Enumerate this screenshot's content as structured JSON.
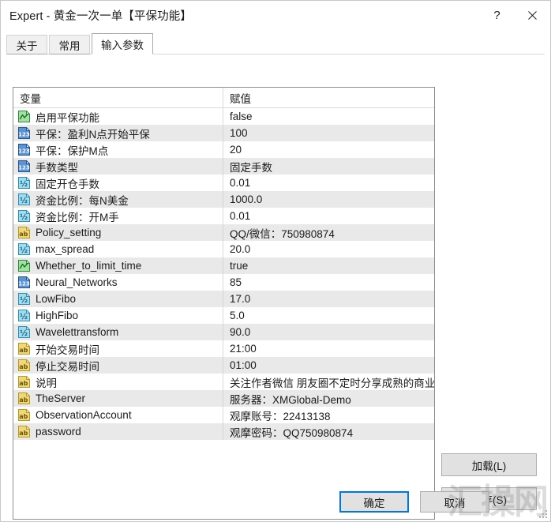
{
  "window": {
    "title": "Expert - 黄金一次一单【平保功能】",
    "help_label": "?",
    "close_label": "✕"
  },
  "tabs": [
    {
      "label": "关于",
      "name": "tab-about",
      "active": false
    },
    {
      "label": "常用",
      "name": "tab-common",
      "active": false
    },
    {
      "label": "输入参数",
      "name": "tab-inputs",
      "active": true
    }
  ],
  "table": {
    "headers": {
      "variable": "变量",
      "value": "赋值"
    },
    "rows": [
      {
        "icon": "bool-icon",
        "name": "启用平保功能",
        "value": "false"
      },
      {
        "icon": "int-icon",
        "name": "平保：盈利N点开始平保",
        "value": "100"
      },
      {
        "icon": "int-icon",
        "name": "平保：保护M点",
        "value": "20"
      },
      {
        "icon": "int-icon",
        "name": "手数类型",
        "value": "固定手数"
      },
      {
        "icon": "double-icon",
        "name": "固定开仓手数",
        "value": "0.01"
      },
      {
        "icon": "double-icon",
        "name": "资金比例：每N美金",
        "value": "1000.0"
      },
      {
        "icon": "double-icon",
        "name": "资金比例：开M手",
        "value": "0.01"
      },
      {
        "icon": "string-icon",
        "name": "Policy_setting",
        "value": "QQ/微信：750980874"
      },
      {
        "icon": "double-icon",
        "name": "max_spread",
        "value": "20.0"
      },
      {
        "icon": "bool-icon",
        "name": "Whether_to_limit_time",
        "value": "true"
      },
      {
        "icon": "int-icon",
        "name": "Neural_Networks",
        "value": "85"
      },
      {
        "icon": "double-icon",
        "name": "LowFibo",
        "value": "17.0"
      },
      {
        "icon": "double-icon",
        "name": "HighFibo",
        "value": "5.0"
      },
      {
        "icon": "double-icon",
        "name": "Wavelettransform",
        "value": "90.0"
      },
      {
        "icon": "string-icon",
        "name": "开始交易时间",
        "value": "21:00"
      },
      {
        "icon": "string-icon",
        "name": "停止交易时间",
        "value": "01:00"
      },
      {
        "icon": "string-icon",
        "name": "说明",
        "value": "关注作者微信 朋友圈不定时分享成熟的商业EA"
      },
      {
        "icon": "string-icon",
        "name": "TheServer",
        "value": "服务器：XMGlobal-Demo"
      },
      {
        "icon": "string-icon",
        "name": "ObservationAccount",
        "value": "观摩账号：22413138"
      },
      {
        "icon": "string-icon",
        "name": "password",
        "value": "观摩密码：QQ750980874"
      }
    ]
  },
  "side_buttons": {
    "load": "加载(L)",
    "save": "保存(S)"
  },
  "footer_buttons": {
    "ok": "确定",
    "cancel": "取消"
  },
  "watermark": {
    "text": "汇操网"
  },
  "colors": {
    "accent": "#0078d7",
    "row_alt": "#e9e9e9",
    "button_face": "#e1e1e1",
    "border": "#8a8f96",
    "bool_icon": "#4caf50",
    "int_icon": "#3c79c8",
    "double_icon": "#47b8d6",
    "string_icon": "#e8c13a"
  }
}
